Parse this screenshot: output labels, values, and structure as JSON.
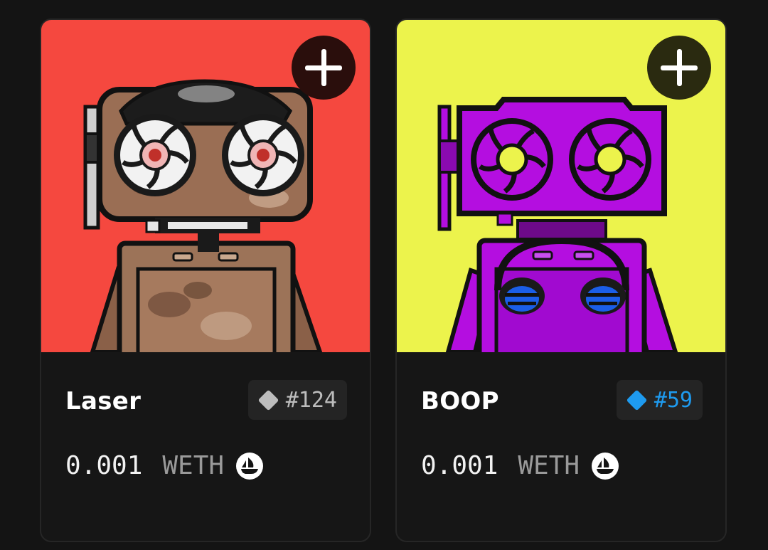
{
  "cards": [
    {
      "name": "Laser",
      "token_id": "#124",
      "price": "0.001",
      "currency": "WETH",
      "rarity_color": "#bdbdbd",
      "token_text_color": "#bdbdbd",
      "bg_color": "#f5483f",
      "button_bg": "#2a0e0c",
      "add_icon": "plus-icon",
      "marketplace_icon": "opensea-icon"
    },
    {
      "name": "BOOP",
      "token_id": "#59",
      "price": "0.001",
      "currency": "WETH",
      "rarity_color": "#1e9bf0",
      "token_text_color": "#1e9bf0",
      "bg_color": "#ecf34c",
      "button_bg": "#2a2a10",
      "add_icon": "plus-icon",
      "marketplace_icon": "opensea-icon"
    }
  ]
}
